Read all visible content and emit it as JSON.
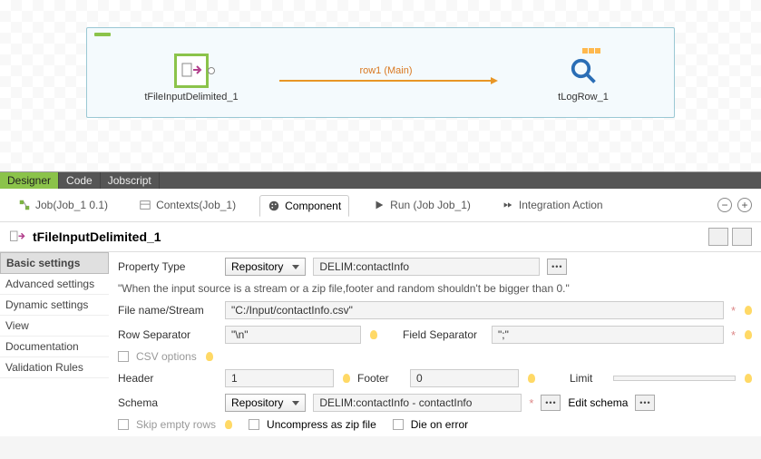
{
  "canvas": {
    "compA": "tFileInputDelimited_1",
    "compB": "tLogRow_1",
    "connLabel": "row1 (Main)"
  },
  "designerTabs": {
    "designer": "Designer",
    "code": "Code",
    "jobscript": "Jobscript"
  },
  "views": {
    "job": "Job(Job_1 0.1)",
    "contexts": "Contexts(Job_1)",
    "component": "Component",
    "run": "Run (Job Job_1)",
    "integration": "Integration Action"
  },
  "componentName": "tFileInputDelimited_1",
  "sidebar": [
    "Basic settings",
    "Advanced settings",
    "Dynamic settings",
    "View",
    "Documentation",
    "Validation Rules"
  ],
  "form": {
    "propTypeLbl": "Property Type",
    "propTypeSel": "Repository",
    "propTypeVal": "DELIM:contactInfo",
    "note": "\"When the input source is a stream or a zip file,footer and random shouldn't be bigger than 0.\"",
    "fileLbl": "File name/Stream",
    "fileVal": "\"C:/Input/contactInfo.csv\"",
    "rowSepLbl": "Row Separator",
    "rowSepVal": "\"\\n\"",
    "fieldSepLbl": "Field Separator",
    "fieldSepVal": "\";\"",
    "csvOpt": "CSV options",
    "headerLbl": "Header",
    "headerVal": "1",
    "footerLbl": "Footer",
    "footerVal": "0",
    "limitLbl": "Limit",
    "limitVal": "",
    "schemaLbl": "Schema",
    "schemaSel": "Repository",
    "schemaVal": "DELIM:contactInfo - contactInfo",
    "editSchema": "Edit schema",
    "skipEmpty": "Skip empty rows",
    "uncompress": "Uncompress as zip file",
    "dieErr": "Die on error"
  }
}
